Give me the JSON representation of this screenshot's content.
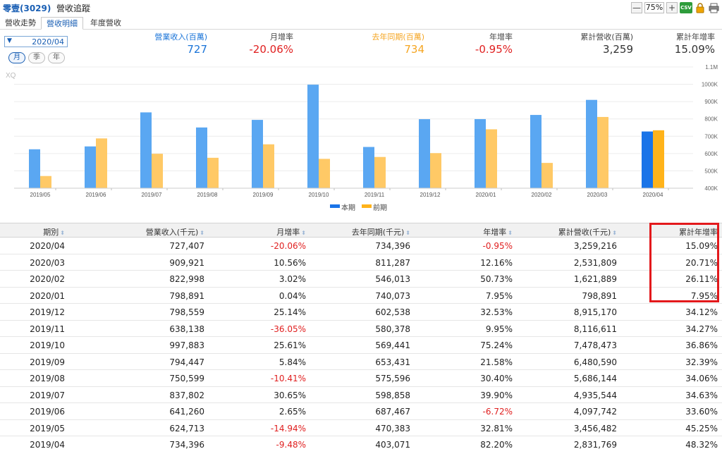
{
  "title": {
    "stock": "零壹(3029)",
    "text": "營收追蹤"
  },
  "toolbar": {
    "zoom": "75%",
    "minus": "—",
    "plus": "+",
    "csv": "CSV"
  },
  "tabs": [
    {
      "label": "營收走勢",
      "active": false
    },
    {
      "label": "營收明細",
      "active": true
    },
    {
      "label": "年度營收",
      "active": false
    }
  ],
  "period": {
    "value": "2020/04",
    "arrow": "▼"
  },
  "pills": [
    {
      "label": "月",
      "active": true
    },
    {
      "label": "季",
      "active": false
    },
    {
      "label": "年",
      "active": false
    }
  ],
  "summary": [
    {
      "label": "營業收入(百萬)",
      "value": "727",
      "label_color": "#1a74d8",
      "value_color": "#1a74d8"
    },
    {
      "label": "月增率",
      "value": "-20.06%",
      "label_color": "#444444",
      "value_color": "#e02020"
    },
    {
      "label": "去年同期(百萬)",
      "value": "734",
      "label_color": "#f5a623",
      "value_color": "#f5a623"
    },
    {
      "label": "年增率",
      "value": "-0.95%",
      "label_color": "#444444",
      "value_color": "#e02020"
    },
    {
      "label": "累計營收(百萬)",
      "value": "3,259",
      "label_color": "#444444",
      "value_color": "#333333"
    },
    {
      "label": "累計年增率",
      "value": "15.09%",
      "label_color": "#444444",
      "value_color": "#333333"
    }
  ],
  "chart_data": {
    "type": "bar",
    "watermark": "XQ",
    "categories": [
      "2019/05",
      "2019/06",
      "2019/07",
      "2019/08",
      "2019/09",
      "2019/10",
      "2019/11",
      "2019/12",
      "2020/01",
      "2020/02",
      "2020/03",
      "2020/04"
    ],
    "series": [
      {
        "name": "本期",
        "color": "#5aa7f2",
        "values": [
          624713,
          641260,
          837802,
          750599,
          794447,
          997883,
          638138,
          798559,
          798891,
          822998,
          909921,
          727407
        ]
      },
      {
        "name": "前期",
        "color": "#ffc966",
        "values": [
          470383,
          687467,
          598858,
          575596,
          653431,
          569441,
          580378,
          602538,
          740073,
          546013,
          811287,
          734396
        ]
      }
    ],
    "highlight_color_current": "#1a74e8",
    "highlight_color_previous": "#ffb31a",
    "ylim": [
      400000,
      1100000
    ],
    "yticks": [
      400000,
      500000,
      600000,
      700000,
      800000,
      900000,
      1000000,
      1100000
    ],
    "ytick_labels": [
      "400K",
      "500K",
      "600K",
      "700K",
      "800K",
      "900K",
      "1000K",
      "1.1M"
    ],
    "grid": true,
    "legend_position": "bottom"
  },
  "table": {
    "headers": [
      "期別",
      "營業收入(千元)",
      "月增率",
      "去年同期(千元)",
      "年增率",
      "累計營收(千元)",
      "累計年增率"
    ],
    "sort_icon": "⬍",
    "rows": [
      [
        "2020/04",
        "727,407",
        "-20.06%",
        "734,396",
        "-0.95%",
        "3,259,216",
        "15.09%"
      ],
      [
        "2020/03",
        "909,921",
        "10.56%",
        "811,287",
        "12.16%",
        "2,531,809",
        "20.71%"
      ],
      [
        "2020/02",
        "822,998",
        "3.02%",
        "546,013",
        "50.73%",
        "1,621,889",
        "26.11%"
      ],
      [
        "2020/01",
        "798,891",
        "0.04%",
        "740,073",
        "7.95%",
        "798,891",
        "7.95%"
      ],
      [
        "2019/12",
        "798,559",
        "25.14%",
        "602,538",
        "32.53%",
        "8,915,170",
        "34.12%"
      ],
      [
        "2019/11",
        "638,138",
        "-36.05%",
        "580,378",
        "9.95%",
        "8,116,611",
        "34.27%"
      ],
      [
        "2019/10",
        "997,883",
        "25.61%",
        "569,441",
        "75.24%",
        "7,478,473",
        "36.86%"
      ],
      [
        "2019/09",
        "794,447",
        "5.84%",
        "653,431",
        "21.58%",
        "6,480,590",
        "32.39%"
      ],
      [
        "2019/08",
        "750,599",
        "-10.41%",
        "575,596",
        "30.40%",
        "5,686,144",
        "34.06%"
      ],
      [
        "2019/07",
        "837,802",
        "30.65%",
        "598,858",
        "39.90%",
        "4,935,544",
        "34.63%"
      ],
      [
        "2019/06",
        "641,260",
        "2.65%",
        "687,467",
        "-6.72%",
        "4,097,742",
        "33.60%"
      ],
      [
        "2019/05",
        "624,713",
        "-14.94%",
        "470,383",
        "32.81%",
        "3,456,482",
        "45.25%"
      ],
      [
        "2019/04",
        "734,396",
        "-9.48%",
        "403,071",
        "82.20%",
        "2,831,769",
        "48.32%"
      ]
    ]
  },
  "colors": {
    "negative": "#e02020",
    "highlight_box": "#e3191c"
  }
}
